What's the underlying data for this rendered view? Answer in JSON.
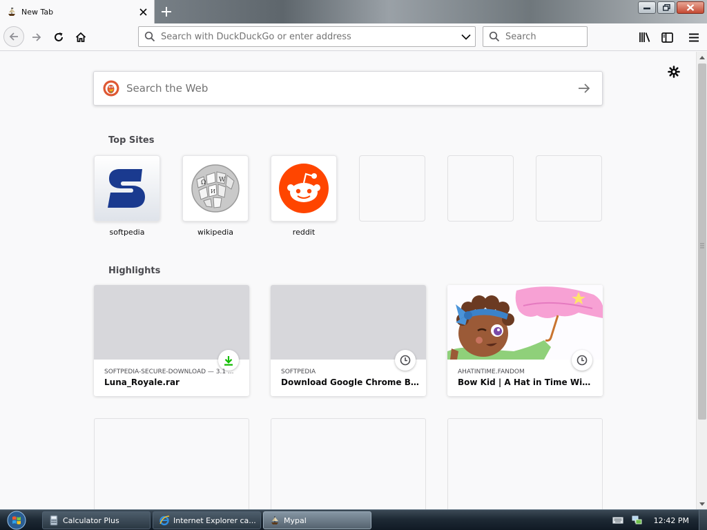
{
  "tab": {
    "title": "New Tab",
    "favicon": "pirate-ship-icon"
  },
  "window_controls": [
    "minimize",
    "restore",
    "close"
  ],
  "toolbar": {
    "urlbar_placeholder": "Search with DuckDuckGo or enter address",
    "searchbar_placeholder": "Search"
  },
  "newtab": {
    "web_search_placeholder": "Search the Web",
    "topsites_heading": "Top Sites",
    "highlights_heading": "Highlights",
    "topsites": [
      {
        "label": "softpedia",
        "icon": "softpedia-logo"
      },
      {
        "label": "wikipedia",
        "icon": "wikipedia-globe-logo"
      },
      {
        "label": "reddit",
        "icon": "reddit-logo"
      },
      {
        "label": "",
        "icon": ""
      },
      {
        "label": "",
        "icon": ""
      },
      {
        "label": "",
        "icon": ""
      }
    ],
    "highlights": [
      {
        "host": "SOFTPEDIA-SECURE-DOWNLOAD — 3.1 ...",
        "title": "Luna_Royale.rar",
        "badge": "download-icon"
      },
      {
        "host": "SOFTPEDIA",
        "title": "Download Google Chrome Back...",
        "badge": "clock-icon"
      },
      {
        "host": "AHATINTIME.FANDOM",
        "title": "Bow Kid | A Hat in Time Wiki | Fa...",
        "badge": "clock-icon"
      }
    ]
  },
  "taskbar": {
    "items": [
      {
        "label": "Calculator Plus",
        "icon": "calculator-icon"
      },
      {
        "label": "Internet Explorer ca...",
        "icon": "internet-explorer-icon"
      },
      {
        "label": "Mypal",
        "icon": "pirate-ship-icon"
      }
    ],
    "clock": "12:42 PM"
  },
  "colors": {
    "download_green": "#12bc00",
    "reddit_orange": "#ff4500",
    "softpedia_blue": "#1a3a8f"
  }
}
